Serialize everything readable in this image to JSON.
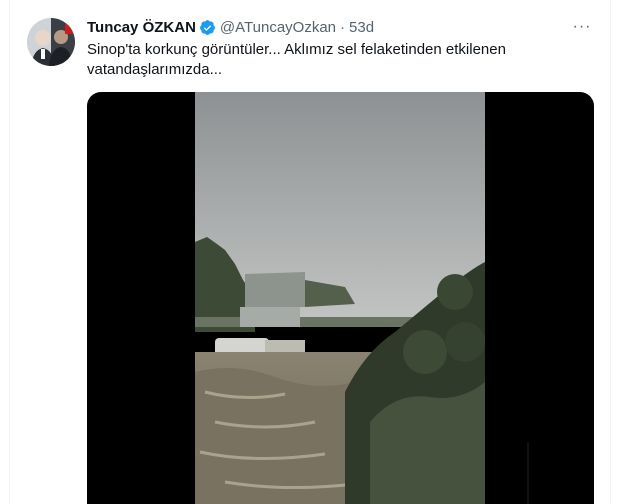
{
  "tweet": {
    "author_name": "Tuncay ÖZKAN",
    "handle": "@ATuncayOzkan",
    "separator": "·",
    "time": "53d",
    "more_label": "···",
    "text": "Sinop'ta korkunç görüntüler... Aklımız sel felaketinden etkilenen vatandaşlarımızda..."
  },
  "icons": {
    "verified": "verified-badge-icon",
    "more": "more-horizontal-icon"
  },
  "colors": {
    "verified": "#1d9bf0",
    "secondary_text": "#536471",
    "primary_text": "#0f1419"
  }
}
